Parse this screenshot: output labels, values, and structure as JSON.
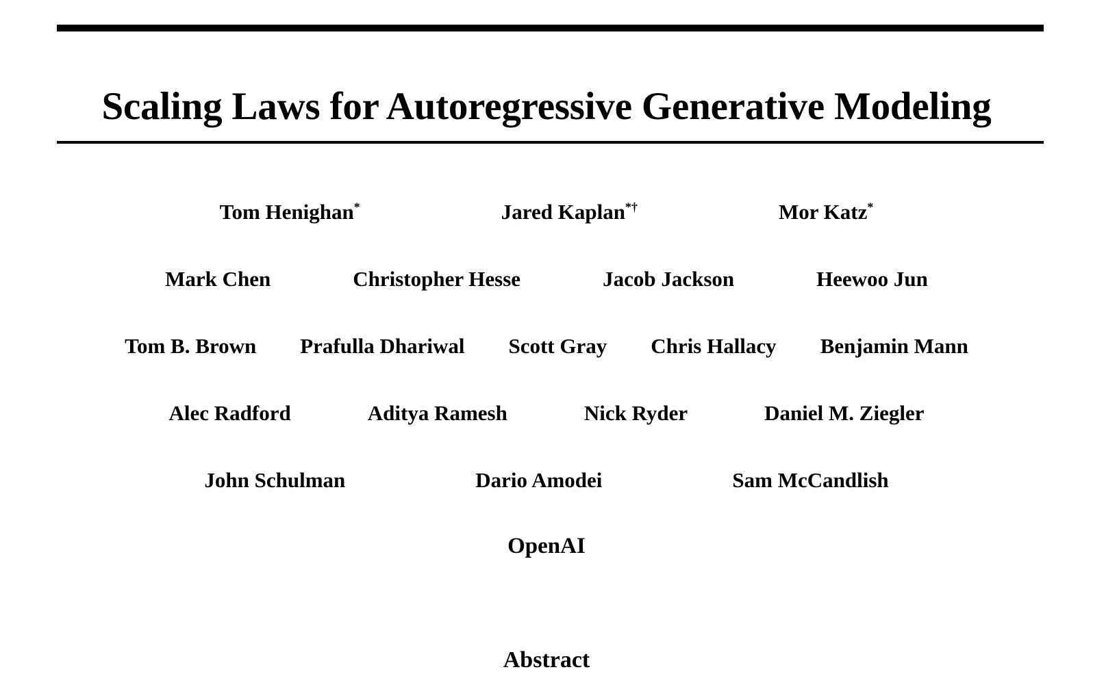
{
  "document": {
    "type": "academic-paper-title-page",
    "title": "Scaling Laws for Autoregressive Generative Modeling",
    "affiliation": "OpenAI",
    "abstract_heading": "Abstract",
    "rules": {
      "top_rule_color": "#000000",
      "bottom_rule_color": "#000000"
    },
    "page_background": "#ffffff",
    "text_color": "#000000"
  },
  "authors": {
    "rows": [
      {
        "index": 1,
        "names": [
          {
            "name": "Tom Henighan",
            "superscript": "*"
          },
          {
            "name": "Jared Kaplan",
            "superscript": "*†"
          },
          {
            "name": "Mor Katz",
            "superscript": "*"
          }
        ]
      },
      {
        "index": 2,
        "names": [
          {
            "name": "Mark Chen",
            "superscript": ""
          },
          {
            "name": "Christopher Hesse",
            "superscript": ""
          },
          {
            "name": "Jacob Jackson",
            "superscript": ""
          },
          {
            "name": "Heewoo Jun",
            "superscript": ""
          }
        ]
      },
      {
        "index": 3,
        "names": [
          {
            "name": "Tom B. Brown",
            "superscript": ""
          },
          {
            "name": "Prafulla Dhariwal",
            "superscript": ""
          },
          {
            "name": "Scott Gray",
            "superscript": ""
          },
          {
            "name": "Chris Hallacy",
            "superscript": ""
          },
          {
            "name": "Benjamin Mann",
            "superscript": ""
          }
        ]
      },
      {
        "index": 4,
        "names": [
          {
            "name": "Alec Radford",
            "superscript": ""
          },
          {
            "name": "Aditya Ramesh",
            "superscript": ""
          },
          {
            "name": "Nick Ryder",
            "superscript": ""
          },
          {
            "name": "Daniel M. Ziegler",
            "superscript": ""
          }
        ]
      },
      {
        "index": 5,
        "names": [
          {
            "name": "John Schulman",
            "superscript": ""
          },
          {
            "name": "Dario Amodei",
            "superscript": ""
          },
          {
            "name": "Sam McCandlish",
            "superscript": ""
          }
        ]
      }
    ]
  }
}
